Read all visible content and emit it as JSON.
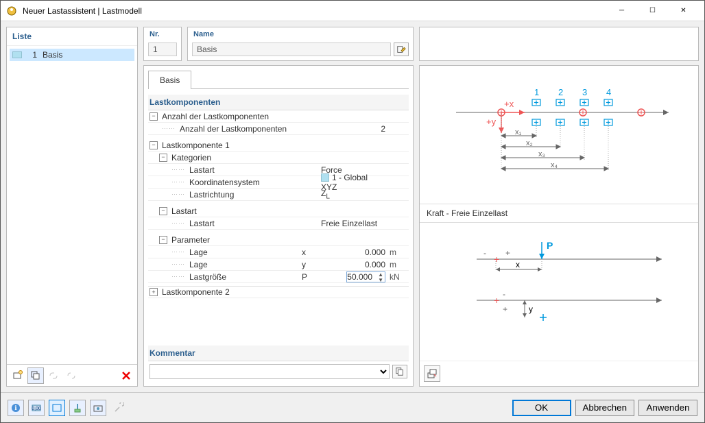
{
  "window": {
    "title": "Neuer Lastassistent | Lastmodell"
  },
  "left": {
    "header": "Liste",
    "items": [
      {
        "num": "1",
        "label": "Basis"
      }
    ]
  },
  "top": {
    "nr_label": "Nr.",
    "nr_value": "1",
    "name_label": "Name",
    "name_value": "Basis"
  },
  "tabs": [
    "Basis"
  ],
  "sections": {
    "lastkomponenten": "Lastkomponenten",
    "anzahl_group": "Anzahl der Lastkomponenten",
    "anzahl_label": "Anzahl der Lastkomponenten",
    "anzahl_value": "2",
    "lk1": "Lastkomponente 1",
    "kategorien": "Kategorien",
    "lastart_label": "Lastart",
    "lastart_value": "Force",
    "koord_label": "Koordinatensystem",
    "koord_value": "1 - Global XYZ",
    "lastrichtung_label": "Lastrichtung",
    "lastrichtung_value": "Z",
    "lastrichtung_sub": "L",
    "lastart_group": "Lastart",
    "lastart2_label": "Lastart",
    "lastart2_value": "Freie Einzellast",
    "parameter": "Parameter",
    "lage1_label": "Lage",
    "lage1_sym": "x",
    "lage1_val": "0.000",
    "lage1_unit": "m",
    "lage2_label": "Lage",
    "lage2_sym": "y",
    "lage2_val": "0.000",
    "lage2_unit": "m",
    "groesse_label": "Lastgröße",
    "groesse_sym": "P",
    "groesse_val": "50.000",
    "groesse_unit": "kN",
    "lk2": "Lastkomponente 2",
    "kommentar": "Kommentar"
  },
  "right": {
    "diagram_title": "Kraft - Freie Einzellast",
    "axis_px": "+x",
    "axis_py": "+y",
    "labels": [
      "1",
      "2",
      "3",
      "4"
    ],
    "dims": [
      "x₁",
      "x₂",
      "x₃",
      "x₄"
    ],
    "p_label": "P",
    "x_label": "x",
    "y_label": "y",
    "minus": "-",
    "plus": "+"
  },
  "buttons": {
    "ok": "OK",
    "cancel": "Abbrechen",
    "apply": "Anwenden"
  }
}
